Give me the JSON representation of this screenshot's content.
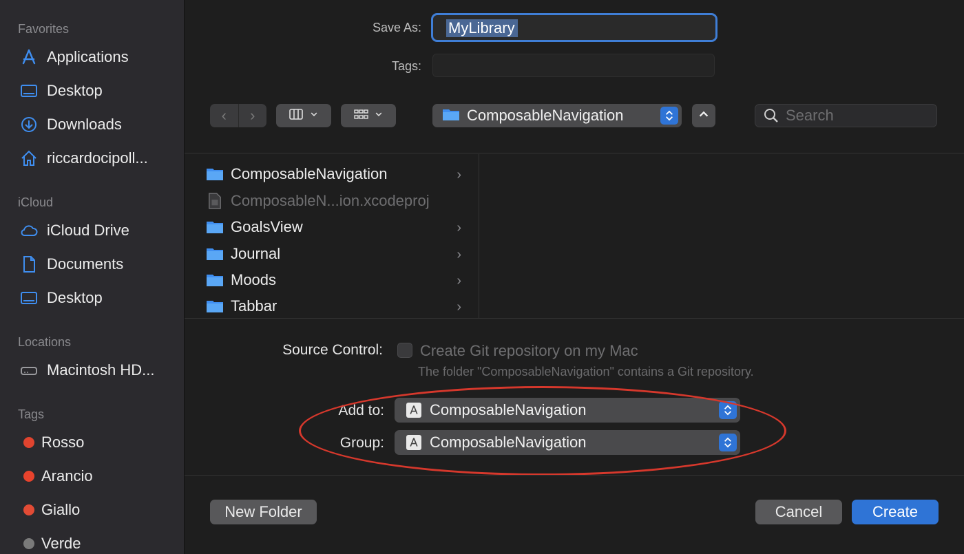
{
  "sidebar": {
    "favorites_header": "Favorites",
    "favorites": [
      {
        "label": "Applications",
        "icon": "applications-icon"
      },
      {
        "label": "Desktop",
        "icon": "desktop-icon"
      },
      {
        "label": "Downloads",
        "icon": "downloads-icon"
      },
      {
        "label": "riccardocipoll...",
        "icon": "home-icon"
      }
    ],
    "icloud_header": "iCloud",
    "icloud": [
      {
        "label": "iCloud Drive",
        "icon": "cloud-icon"
      },
      {
        "label": "Documents",
        "icon": "document-icon"
      },
      {
        "label": "Desktop",
        "icon": "desktop-icon"
      }
    ],
    "locations_header": "Locations",
    "locations": [
      {
        "label": "Macintosh HD...",
        "icon": "drive-icon"
      }
    ],
    "tags_header": "Tags",
    "tags": [
      {
        "label": "Rosso",
        "color": "#e0442f"
      },
      {
        "label": "Arancio",
        "color": "#e8432d"
      },
      {
        "label": "Giallo",
        "color": "#e24b35"
      },
      {
        "label": "Verde",
        "color": "#7a7a7a"
      }
    ]
  },
  "save": {
    "save_as_label": "Save As:",
    "save_as_value": "MyLibrary",
    "tags_label": "Tags:",
    "tags_value": ""
  },
  "toolbar": {
    "back_icon": "chevron-left-icon",
    "forward_icon": "chevron-right-icon",
    "column_view_icon": "columns-icon",
    "group_icon": "grid-icon",
    "path_value": "ComposableNavigation",
    "up_icon": "chevron-up-icon",
    "search_placeholder": "Search"
  },
  "files": [
    {
      "name": "ComposableNavigation",
      "kind": "folder",
      "has_children": true,
      "dim": false
    },
    {
      "name": "ComposableN...ion.xcodeproj",
      "kind": "xcodeproj",
      "has_children": false,
      "dim": true
    },
    {
      "name": "GoalsView",
      "kind": "folder",
      "has_children": true,
      "dim": false
    },
    {
      "name": "Journal",
      "kind": "folder",
      "has_children": true,
      "dim": false
    },
    {
      "name": "Moods",
      "kind": "folder",
      "has_children": true,
      "dim": false
    },
    {
      "name": "Tabbar",
      "kind": "folder",
      "has_children": true,
      "dim": false
    }
  ],
  "options": {
    "source_control_label": "Source Control:",
    "git_checkbox_label": "Create Git repository on my Mac",
    "git_note": "The folder \"ComposableNavigation\" contains a Git repository.",
    "add_to_label": "Add to:",
    "add_to_value": "ComposableNavigation",
    "group_label": "Group:",
    "group_value": "ComposableNavigation"
  },
  "buttons": {
    "new_folder": "New Folder",
    "cancel": "Cancel",
    "create": "Create"
  },
  "colors": {
    "accent": "#2f74d6",
    "annotation": "#d6382c"
  }
}
